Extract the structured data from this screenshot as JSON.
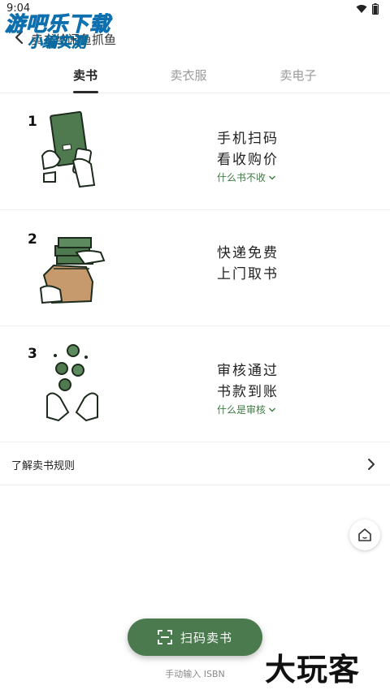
{
  "status_bar": {
    "time": "9:04",
    "icons": [
      "wifi-icon",
      "battery-icon"
    ]
  },
  "header": {
    "title": "卖书给闲鱼抓鱼",
    "back_icon": "chevron-left-icon"
  },
  "watermark_top": {
    "line1": "游吧乐下载",
    "line2": "小编实测"
  },
  "tabs": [
    {
      "label": "卖书",
      "active": true
    },
    {
      "label": "卖衣服",
      "active": false
    },
    {
      "label": "卖电子",
      "active": false
    }
  ],
  "steps": [
    {
      "number": "1",
      "line1": "手机扫码",
      "line2": "看收购价",
      "link": "什么书不收",
      "illustration": "book-scan-illustration"
    },
    {
      "number": "2",
      "line1": "快递免费",
      "line2": "上门取书",
      "link": "",
      "illustration": "parcel-pickup-illustration"
    },
    {
      "number": "3",
      "line1": "审核通过",
      "line2": "书款到账",
      "link": "什么是审核",
      "illustration": "coins-payout-illustration"
    }
  ],
  "rules": {
    "label": "了解卖书规则"
  },
  "scan_button": {
    "label": "扫码卖书",
    "icon": "scan-icon"
  },
  "manual_link": "手动输入 ISBN",
  "watermark_bottom": "大玩客",
  "colors": {
    "accent": "#4a7a4e",
    "link": "#3c7a42"
  }
}
